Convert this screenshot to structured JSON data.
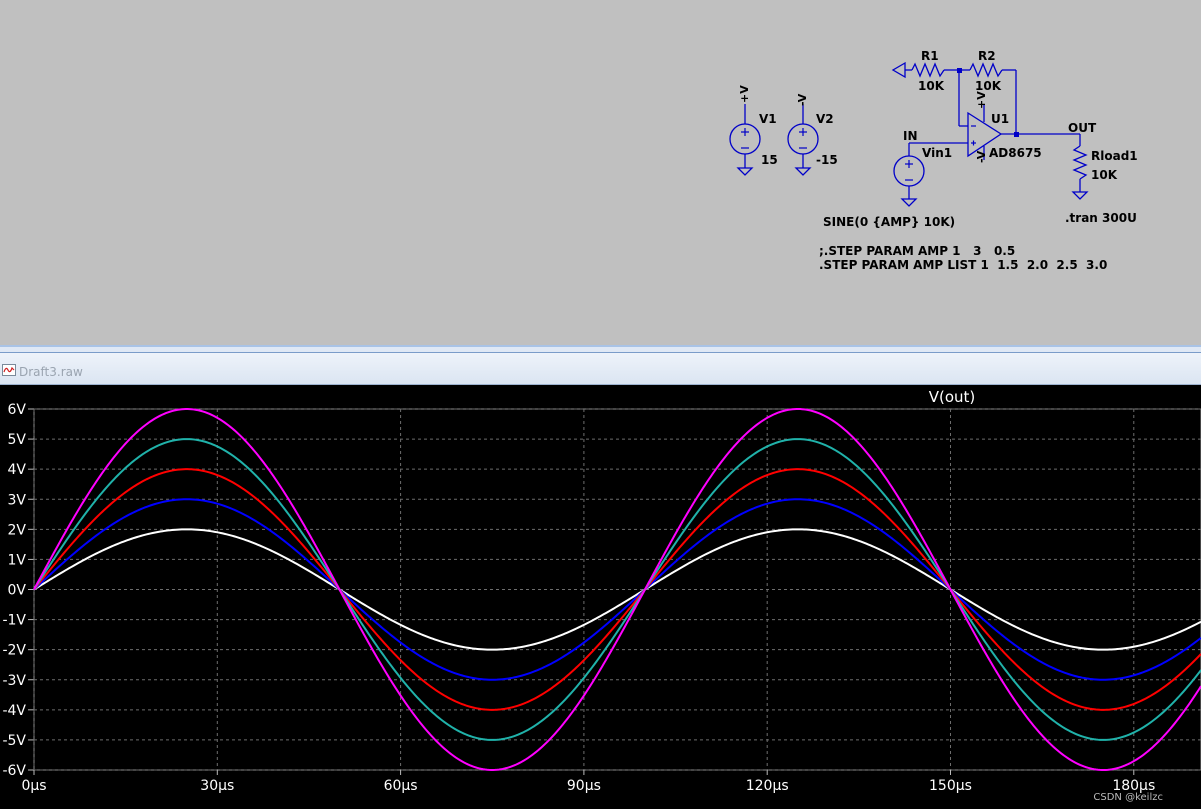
{
  "schematic": {
    "components": {
      "r1_name": "R1",
      "r1_value": "10K",
      "r2_name": "R2",
      "r2_value": "10K",
      "u1_name": "U1",
      "u1_model": "AD8675",
      "v1_name": "V1",
      "v1_value": "15",
      "v2_name": "V2",
      "v2_value": "-15",
      "vin_name": "Vin1",
      "rload_name": "Rload1",
      "rload_value": "10K"
    },
    "nets": {
      "in": "IN",
      "out": "OUT",
      "plus_v": "+V",
      "minus_v": "-V",
      "vpos_label": "+V",
      "vneg_label": "-V"
    },
    "directives": {
      "sine": "SINE(0 {AMP} 10K)",
      "tran": ".tran 300U",
      "step_commented": ";.STEP PARAM AMP 1   3   0.5",
      "step_list": ".STEP PARAM AMP LIST 1  1.5  2.0  2.5  3.0"
    }
  },
  "waveform_window": {
    "title": "Draft3.raw",
    "watermark": "CSDN @keilzc"
  },
  "chart_data": {
    "type": "line",
    "title": "V(out)",
    "xlabel": "",
    "ylabel": "",
    "x_ticks": [
      "0µs",
      "30µs",
      "60µs",
      "90µs",
      "120µs",
      "150µs",
      "180µs"
    ],
    "y_ticks": [
      "6V",
      "5V",
      "4V",
      "3V",
      "2V",
      "1V",
      "0V",
      "-1V",
      "-2V",
      "-3V",
      "-4V",
      "-5V",
      "-6V"
    ],
    "xlim": [
      0,
      191
    ],
    "ylim": [
      -6,
      6
    ],
    "grid": true,
    "frequency_khz": 10,
    "series": [
      {
        "amplitude": 2,
        "color": "#ffffff"
      },
      {
        "amplitude": 3,
        "color": "#0000ff"
      },
      {
        "amplitude": 4,
        "color": "#ff0000"
      },
      {
        "amplitude": 5,
        "color": "#20b2aa"
      },
      {
        "amplitude": 6,
        "color": "#ff00ff"
      }
    ]
  }
}
